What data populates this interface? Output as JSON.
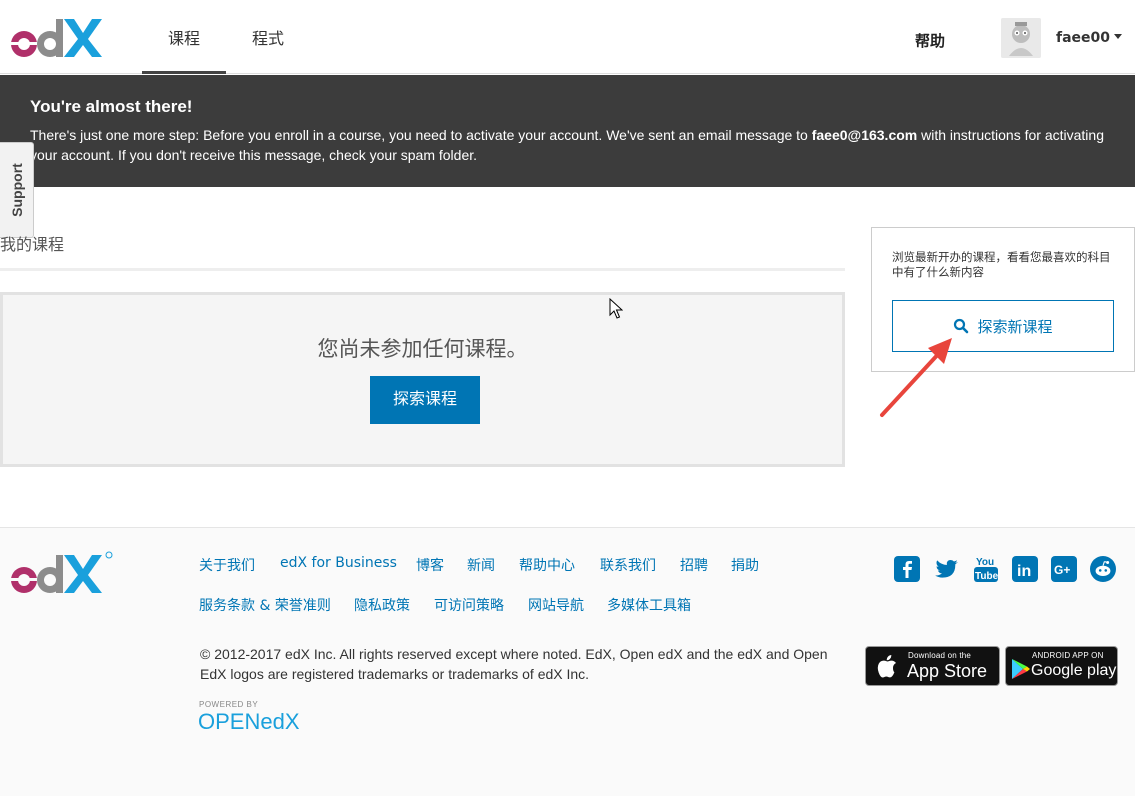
{
  "header": {
    "logo_text": "edX",
    "tabs": [
      {
        "label": "课程",
        "active": true
      },
      {
        "label": "程式",
        "active": false
      }
    ],
    "help_label": "帮助",
    "username": "faee00"
  },
  "banner": {
    "title": "You're almost there!",
    "message_before": "There's just one more step: Before you enroll in a course, you need to activate your account. We've sent an email message to ",
    "email": "faee0@163.com",
    "message_after": " with instructions for activating your account. If you don't receive this message, check your spam folder."
  },
  "support_label": "Support",
  "main": {
    "title": "我的课程",
    "empty_message": "您尚未参加任何课程。",
    "explore_button": "探索课程"
  },
  "sidebar": {
    "text": "浏览最新开办的课程，看看您最喜欢的科目中有了什么新内容",
    "button_label": "探索新课程"
  },
  "footer": {
    "links_row1": [
      "关于我们",
      "edX for Business",
      "博客",
      "新闻",
      "帮助中心",
      "联系我们",
      "招聘",
      "捐助"
    ],
    "links_row2": [
      "服务条款 & 荣誉准则",
      "隐私政策",
      "可访问策略",
      "网站导航",
      "多媒体工具箱"
    ],
    "copyright": "© 2012-2017 edX Inc. All rights reserved except where noted. EdX, Open edX and the edX and Open EdX logos are registered trademarks or trademarks of edX Inc.",
    "powered_by": "POWERED BY",
    "powered_brand": "OPENedX",
    "social": [
      "facebook-icon",
      "twitter-icon",
      "youtube-icon",
      "linkedin-icon",
      "google-plus-icon",
      "reddit-icon"
    ],
    "youtube_top": "You",
    "youtube_bottom": "Tube",
    "linkedin_text": "in",
    "google_plus_text": "G+",
    "app_store_small": "Download on the",
    "app_store_big": "App Store",
    "google_play_small": "ANDROID APP ON",
    "google_play_big": "Google play"
  },
  "colors": {
    "brand_blue": "#0075b4",
    "banner_bg": "#3c3c3c",
    "logo_magenta": "#b0306a",
    "logo_grey": "#8c8c8c",
    "logo_cyan": "#1aa0dc",
    "arrow_red": "#e8453c"
  }
}
